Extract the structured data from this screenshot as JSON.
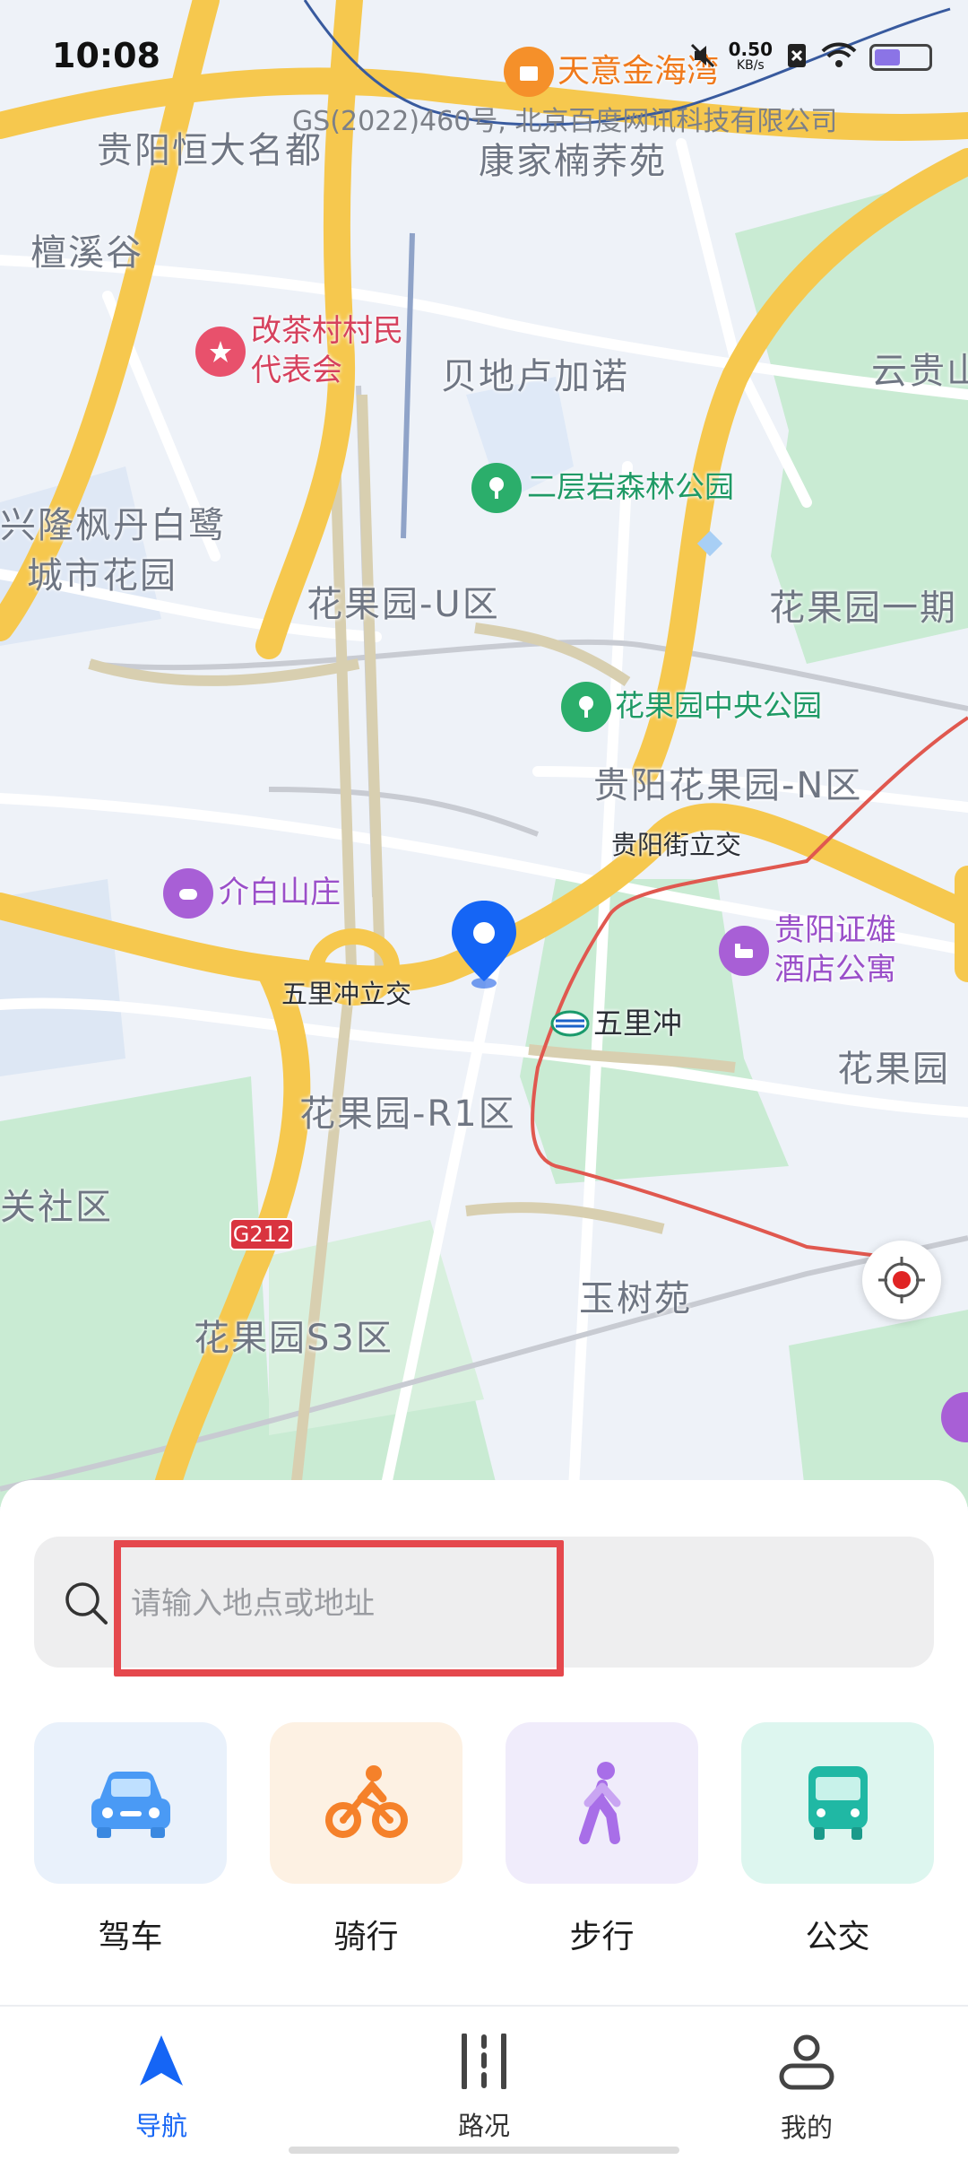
{
  "status_bar": {
    "time": "10:08",
    "net_speed_value": "0.50",
    "net_speed_unit": "KB/s"
  },
  "map": {
    "copyright": "GS(2022)460号, 北京百度网讯科技有限公司",
    "labels": {
      "guiyang_hengda": "贵阳恒大名都",
      "kangjia": "康家楠荞苑",
      "tanxigu": "檀溪谷",
      "gaichacun_1": "改茶村村民",
      "gaichacun_2": "代表会",
      "beidilu": "贝地卢加诺",
      "erceng": "二层岩森林公园",
      "yungui": "云贵山",
      "xinglong_1": "兴隆枫丹白鹭",
      "xinglong_2": "城市花园",
      "huaguoyuan_u": "花果园-U区",
      "huaguoyuan_1qi": "花果园一期",
      "zhongyang": "花果园中央公园",
      "huaguoyuan_n": "贵阳花果园-N区",
      "guiyangjie": "贵阳街立交",
      "jiebai": "介白山庄",
      "zhengxiong_1": "贵阳证雄",
      "zhengxiong_2": "酒店公寓",
      "wulichong_lijiao": "五里冲立交",
      "wulichong": "五里冲",
      "huaguoyuan_right": "花果园",
      "huaguoyuan_r1": "花果园-R1区",
      "guanshe": "关社区",
      "g212": "G212",
      "yushuyuan": "玉树苑",
      "huaguoyuan_s3": "花果园S3区",
      "tianyi": "天意金海湾"
    }
  },
  "search": {
    "placeholder": "请输入地点或地址",
    "value": ""
  },
  "modes": [
    {
      "label": "驾车",
      "icon": "car-icon",
      "color": "#4a9af5"
    },
    {
      "label": "骑行",
      "icon": "bike-icon",
      "color": "#f5812a"
    },
    {
      "label": "步行",
      "icon": "walk-icon",
      "color": "#a86ee8"
    },
    {
      "label": "公交",
      "icon": "bus-icon",
      "color": "#20b8a4"
    }
  ],
  "tabs": [
    {
      "label": "导航",
      "icon": "navigation-icon",
      "active": true
    },
    {
      "label": "路况",
      "icon": "traffic-icon",
      "active": false
    },
    {
      "label": "我的",
      "icon": "profile-icon",
      "active": false
    }
  ],
  "colors": {
    "accent": "#1565f5",
    "highlight": "#e5484d",
    "green_area": "#c9ebd3",
    "road_yellow": "#f6c84e"
  }
}
